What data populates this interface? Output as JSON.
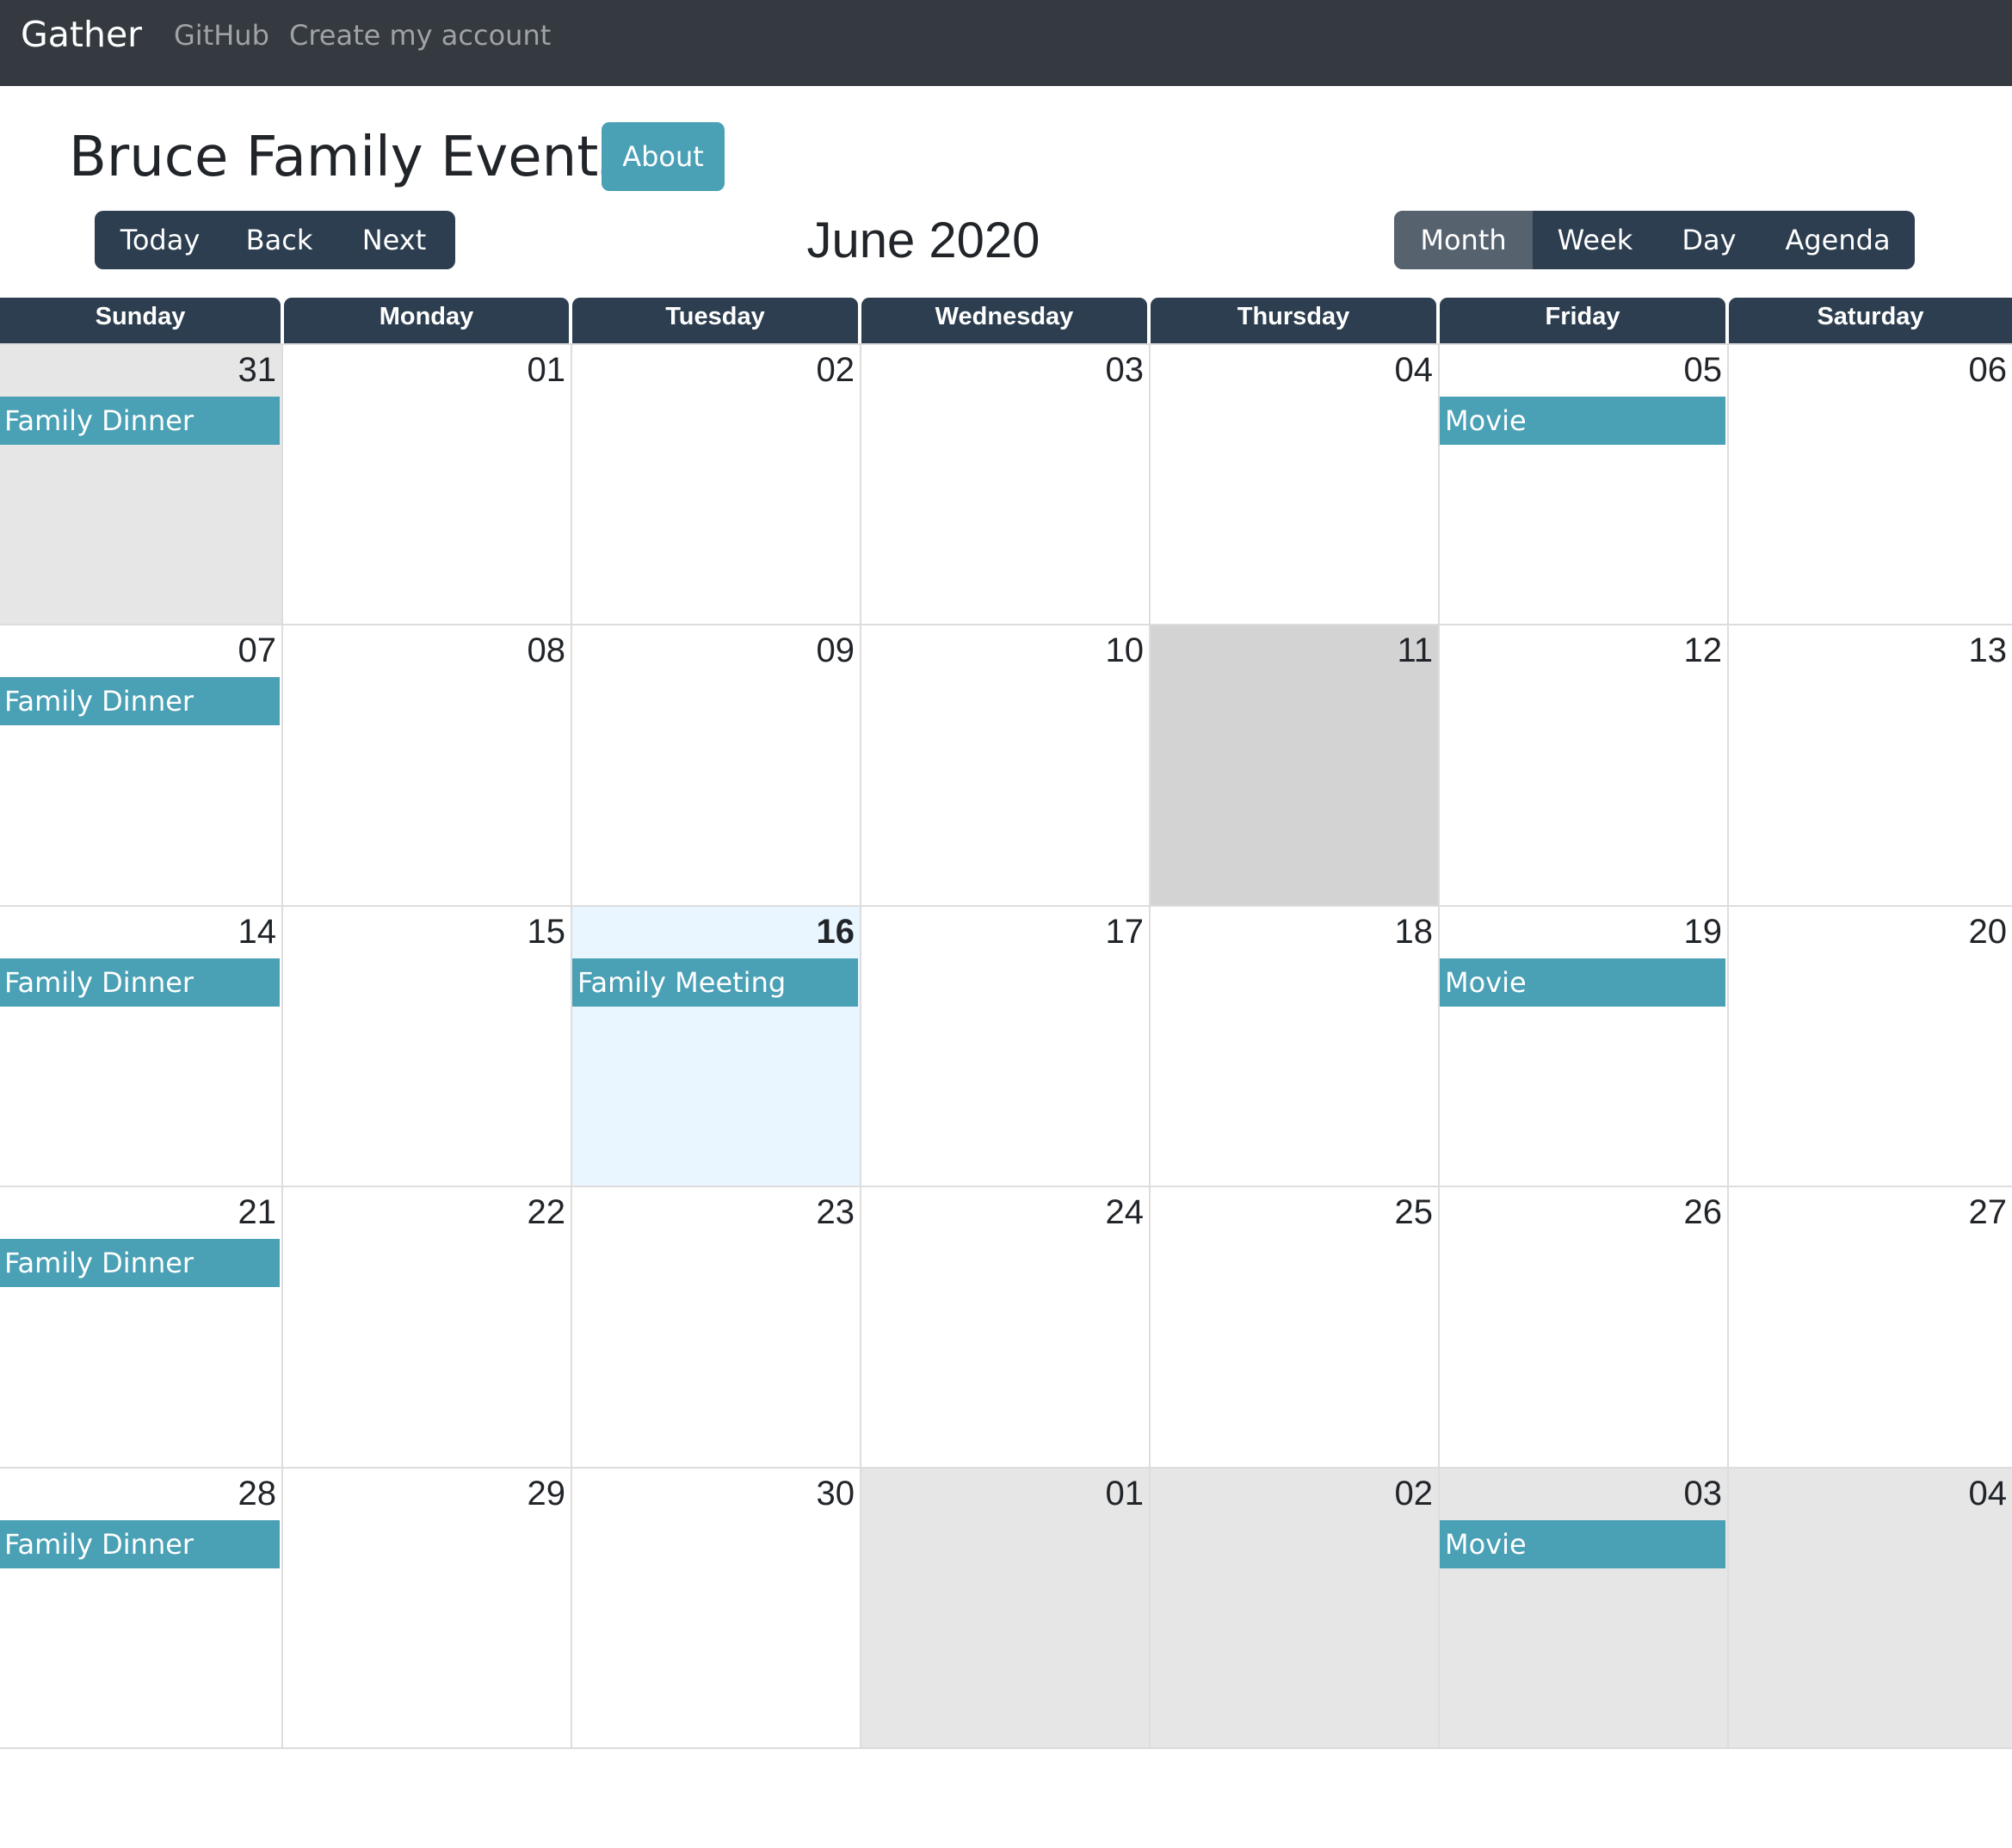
{
  "navbar": {
    "brand": "Gather",
    "links": [
      "GitHub",
      "Create my account"
    ]
  },
  "header": {
    "title": "Bruce Family Events",
    "about_label": "About"
  },
  "toolbar": {
    "nav_buttons": [
      "Today",
      "Back",
      "Next"
    ],
    "label": "June 2020",
    "views": [
      "Month",
      "Week",
      "Day",
      "Agenda"
    ],
    "active_view": "Month"
  },
  "calendar": {
    "weekdays": [
      "Sunday",
      "Monday",
      "Tuesday",
      "Wednesday",
      "Thursday",
      "Friday",
      "Saturday"
    ],
    "weeks": [
      [
        {
          "date": "31",
          "off_month": true,
          "events": [
            "Family Dinner"
          ]
        },
        {
          "date": "01",
          "events": []
        },
        {
          "date": "02",
          "events": []
        },
        {
          "date": "03",
          "events": []
        },
        {
          "date": "04",
          "events": []
        },
        {
          "date": "05",
          "events": [
            "Movie"
          ]
        },
        {
          "date": "06",
          "events": []
        }
      ],
      [
        {
          "date": "07",
          "events": [
            "Family Dinner"
          ]
        },
        {
          "date": "08",
          "events": []
        },
        {
          "date": "09",
          "events": []
        },
        {
          "date": "10",
          "events": []
        },
        {
          "date": "11",
          "selected": true,
          "events": []
        },
        {
          "date": "12",
          "events": []
        },
        {
          "date": "13",
          "events": []
        }
      ],
      [
        {
          "date": "14",
          "events": [
            "Family Dinner"
          ]
        },
        {
          "date": "15",
          "events": []
        },
        {
          "date": "16",
          "today": true,
          "events": [
            "Family Meeting"
          ]
        },
        {
          "date": "17",
          "events": []
        },
        {
          "date": "18",
          "events": []
        },
        {
          "date": "19",
          "events": [
            "Movie"
          ]
        },
        {
          "date": "20",
          "events": []
        }
      ],
      [
        {
          "date": "21",
          "events": [
            "Family Dinner"
          ]
        },
        {
          "date": "22",
          "events": []
        },
        {
          "date": "23",
          "events": []
        },
        {
          "date": "24",
          "events": []
        },
        {
          "date": "25",
          "events": []
        },
        {
          "date": "26",
          "events": []
        },
        {
          "date": "27",
          "events": []
        }
      ],
      [
        {
          "date": "28",
          "events": [
            "Family Dinner"
          ]
        },
        {
          "date": "29",
          "events": []
        },
        {
          "date": "30",
          "events": []
        },
        {
          "date": "01",
          "off_month": true,
          "events": []
        },
        {
          "date": "02",
          "off_month": true,
          "events": []
        },
        {
          "date": "03",
          "off_month": true,
          "events": [
            "Movie"
          ]
        },
        {
          "date": "04",
          "off_month": true,
          "events": []
        }
      ]
    ]
  },
  "colors": {
    "navbar_bg": "#343a40",
    "toolbar_bg": "#2c3e50",
    "active_view_bg": "#56626e",
    "event_bg": "#4aa0b5",
    "off_month_bg": "#e6e6e6",
    "selected_bg": "#d3d3d3",
    "today_bg": "#eaf6ff"
  }
}
